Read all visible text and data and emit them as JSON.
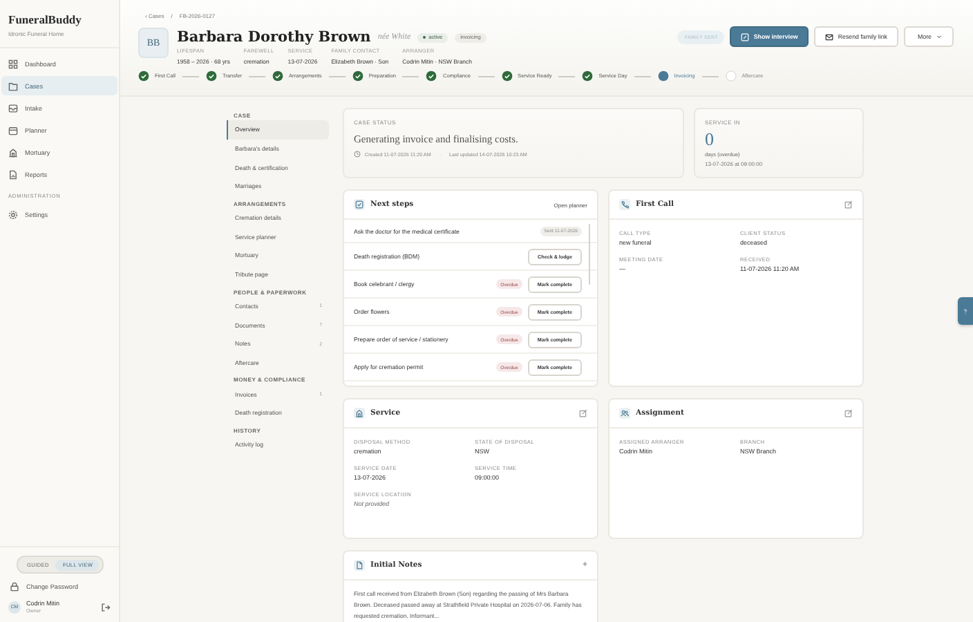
{
  "sidebar": {
    "brand": "FuneralBuddy",
    "org": "Idronic Funeral Home",
    "nav": [
      {
        "kind": "item",
        "label": "Dashboard",
        "selected": false
      },
      {
        "kind": "item",
        "label": "Cases",
        "selected": true
      },
      {
        "kind": "item",
        "label": "Intake",
        "selected": false
      },
      {
        "kind": "item",
        "label": "Planner",
        "selected": false
      },
      {
        "kind": "item",
        "label": "Mortuary",
        "selected": false
      },
      {
        "kind": "item",
        "label": "Reports",
        "selected": false
      },
      {
        "kind": "heading",
        "label": "ADMINISTRATION"
      },
      {
        "kind": "item",
        "label": "Settings",
        "selected": false
      }
    ],
    "view_toggle": [
      {
        "label": "GUIDED",
        "selected": false
      },
      {
        "label": "FULL VIEW",
        "selected": true
      }
    ],
    "change_password": "Change Password",
    "user": {
      "initials": "CM",
      "name": "Codrin Mitin",
      "role": "Owner"
    }
  },
  "breadcrumb": {
    "back": "‹ Cases",
    "separator": "/",
    "current": "FB-2026-0127"
  },
  "case": {
    "initials": "BB",
    "name": "Barbara Dorothy Brown",
    "maiden": "née White",
    "badges": [
      {
        "kind": "status",
        "text": "active"
      },
      {
        "kind": "tag",
        "text": "invoicing"
      }
    ],
    "meta": [
      {
        "label": "LIFESPAN",
        "value": "1958 – 2026 · 68 yrs"
      },
      {
        "label": "FAREWELL",
        "value": "cremation"
      },
      {
        "label": "SERVICE",
        "value": "13-07-2026"
      },
      {
        "label": "FAMILY CONTACT",
        "value": "Elizabeth Brown · Son"
      },
      {
        "label": "ARRANGER",
        "value": "Codrin Mitin · NSW Branch"
      }
    ]
  },
  "family_status": "FAMILY SENT",
  "actions": [
    {
      "kind": "primary",
      "label": "Show interview"
    },
    {
      "kind": "secondary",
      "label": "Resend family link"
    },
    {
      "kind": "menu",
      "label": "More"
    }
  ],
  "steps": [
    {
      "label": "First Call",
      "done": true,
      "current": false
    },
    {
      "label": "Transfer",
      "done": true,
      "current": false
    },
    {
      "label": "Arrangements",
      "done": true,
      "current": false
    },
    {
      "label": "Preparation",
      "done": true,
      "current": false
    },
    {
      "label": "Compliance",
      "done": true,
      "current": false
    },
    {
      "label": "Service Ready",
      "done": true,
      "current": false
    },
    {
      "label": "Service Day",
      "done": true,
      "current": false
    },
    {
      "label": "Invoicing",
      "done": false,
      "current": true
    },
    {
      "label": "Aftercare",
      "done": false,
      "current": false
    }
  ],
  "subnav": [
    {
      "title": "CASE",
      "items": [
        {
          "label": "Overview",
          "selected": true
        },
        {
          "label": "Barbara's details",
          "selected": false
        },
        {
          "label": "Death & certification",
          "selected": false
        },
        {
          "label": "Marriages",
          "selected": false
        }
      ]
    },
    {
      "title": "ARRANGEMENTS",
      "items": [
        {
          "label": "Cremation details",
          "selected": false
        },
        {
          "label": "Service planner",
          "selected": false
        },
        {
          "label": "Mortuary",
          "selected": false
        },
        {
          "label": "Tribute page",
          "selected": false
        }
      ]
    },
    {
      "title": "PEOPLE & PAPERWORK",
      "items": [
        {
          "label": "Contacts",
          "count": "1",
          "selected": false
        },
        {
          "label": "Documents",
          "count": "7",
          "selected": false
        },
        {
          "label": "Notes",
          "count": "2",
          "selected": false
        },
        {
          "label": "Aftercare",
          "selected": false
        }
      ]
    },
    {
      "title": "MONEY & COMPLIANCE",
      "items": [
        {
          "label": "Invoices",
          "count": "1",
          "selected": false
        },
        {
          "label": "Death registration",
          "selected": false
        }
      ]
    },
    {
      "title": "HISTORY",
      "items": [
        {
          "label": "Activity log",
          "selected": false
        }
      ]
    }
  ],
  "case_status": {
    "label": "CASE STATUS",
    "text": "Generating invoice and finalising costs.",
    "created": "Created 11-07-2026 11:20 AM",
    "separator": "·",
    "updated": "Last updated 14-07-2026 10:23 AM"
  },
  "service_in": {
    "label": "SERVICE IN",
    "value": "0",
    "unit": "days (overdue)",
    "when": "13-07-2026 at 09:00:00"
  },
  "next_steps": {
    "title": "Next steps",
    "link": "Open planner",
    "rows": [
      {
        "task": "Ask the doctor for the medical certificate",
        "tag": {
          "kind": "sent",
          "text": "Sent 11-07-2026"
        }
      },
      {
        "task": "Death registration (BDM)",
        "action": "Check & lodge"
      },
      {
        "task": "Book celebrant / clergy",
        "tag": {
          "kind": "overdue",
          "text": "Overdue"
        },
        "action": "Mark complete"
      },
      {
        "task": "Order flowers",
        "tag": {
          "kind": "overdue",
          "text": "Overdue"
        },
        "action": "Mark complete"
      },
      {
        "task": "Prepare order of service / stationery",
        "tag": {
          "kind": "overdue",
          "text": "Overdue"
        },
        "action": "Mark complete"
      },
      {
        "task": "Apply for cremation permit",
        "tag": {
          "kind": "overdue",
          "text": "Overdue"
        },
        "action": "Mark complete"
      }
    ]
  },
  "first_call": {
    "title": "First Call",
    "fields": [
      {
        "label": "CALL TYPE",
        "value": "new funeral"
      },
      {
        "label": "CLIENT STATUS",
        "value": "deceased"
      },
      {
        "label": "MEETING DATE",
        "value": "—"
      },
      {
        "label": "RECEIVED",
        "value": "11-07-2026 11:20 AM"
      }
    ]
  },
  "service": {
    "title": "Service",
    "fields": [
      {
        "label": "DISPOSAL METHOD",
        "value": "cremation"
      },
      {
        "label": "STATE OF DISPOSAL",
        "value": "NSW"
      },
      {
        "label": "SERVICE DATE",
        "value": "13-07-2026"
      },
      {
        "label": "SERVICE TIME",
        "value": "09:00:00"
      },
      {
        "label": "SERVICE LOCATION",
        "value": "Not provided",
        "empty": true
      }
    ]
  },
  "assignment": {
    "title": "Assignment",
    "fields": [
      {
        "label": "ASSIGNED ARRANGER",
        "value": "Codrin Mitin"
      },
      {
        "label": "BRANCH",
        "value": "NSW Branch"
      }
    ]
  },
  "initial_notes": {
    "title": "Initial Notes",
    "add": "+",
    "text": "First call received from Elizabeth Brown (Son) regarding the passing of Mrs Barbara Brown. Deceased passed away at Strathfield Private Hospital on 2026-07-06. Family has requested cremation. Informant..."
  }
}
